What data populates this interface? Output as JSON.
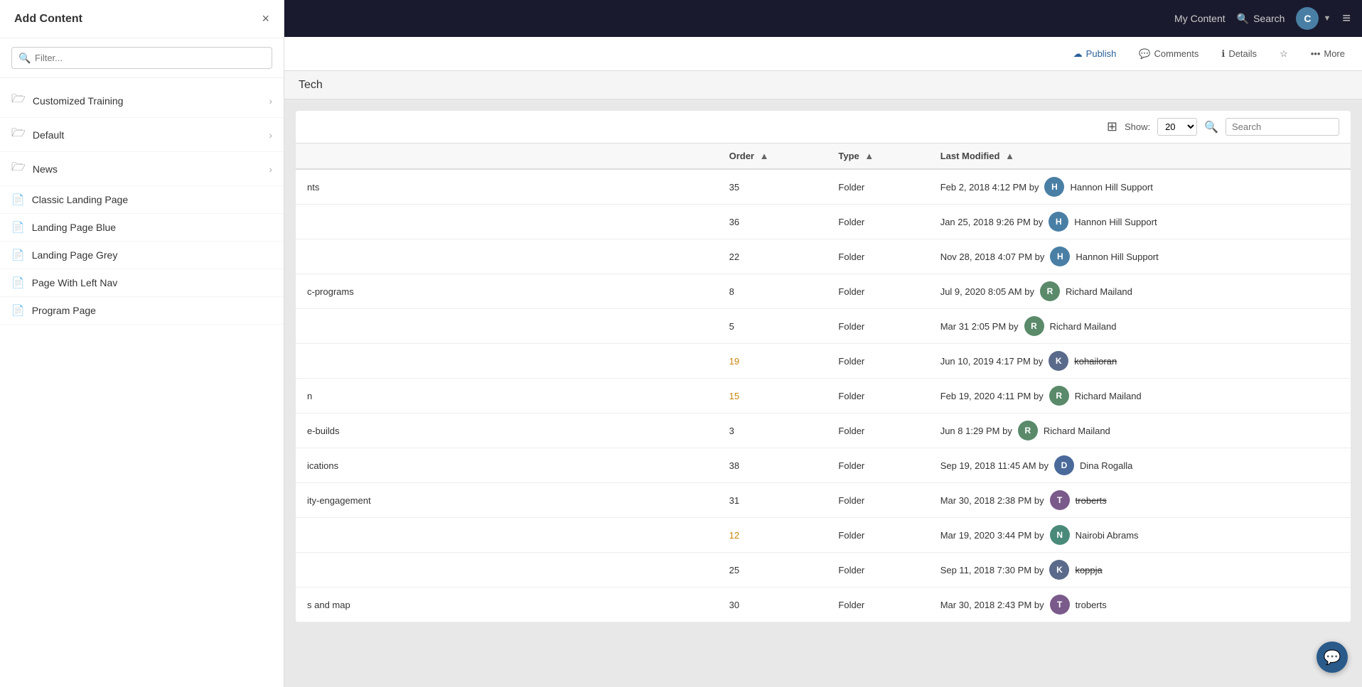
{
  "topnav": {
    "my_content_label": "My Content",
    "search_label": "Search",
    "avatar_letter": "C",
    "hamburger": "≡"
  },
  "secondary_toolbar": {
    "publish_label": "Publish",
    "comments_label": "Comments",
    "details_label": "Details",
    "more_label": "More"
  },
  "page_title": "Tech",
  "list_toolbar": {
    "show_label": "Show:",
    "show_value": "20",
    "search_placeholder": "Search"
  },
  "table": {
    "columns": [
      {
        "key": "name",
        "label": ""
      },
      {
        "key": "order",
        "label": "Order",
        "sortable": true
      },
      {
        "key": "type",
        "label": "Type",
        "sortable": true
      },
      {
        "key": "last_modified",
        "label": "Last Modified",
        "sortable": true
      }
    ],
    "rows": [
      {
        "name": "nts",
        "order": "35",
        "order_highlight": false,
        "type": "Folder",
        "date": "Feb 2, 2018 4:12 PM",
        "by": "by",
        "user_avatar": "H",
        "user_avatar_class": "ua-h",
        "user_name": "Hannon Hill Support",
        "strikethrough": false
      },
      {
        "name": "",
        "order": "36",
        "order_highlight": false,
        "type": "Folder",
        "date": "Jan 25, 2018 9:26 PM",
        "by": "by",
        "user_avatar": "H",
        "user_avatar_class": "ua-h",
        "user_name": "Hannon Hill Support",
        "strikethrough": false
      },
      {
        "name": "",
        "order": "22",
        "order_highlight": false,
        "type": "Folder",
        "date": "Nov 28, 2018 4:07 PM",
        "by": "by",
        "user_avatar": "H",
        "user_avatar_class": "ua-h",
        "user_name": "Hannon Hill Support",
        "strikethrough": false
      },
      {
        "name": "c-programs",
        "order": "8",
        "order_highlight": false,
        "type": "Folder",
        "date": "Jul 9, 2020 8:05 AM",
        "by": "by",
        "user_avatar": "R",
        "user_avatar_class": "ua-r",
        "user_name": "Richard Mailand",
        "strikethrough": false
      },
      {
        "name": "",
        "order": "5",
        "order_highlight": false,
        "type": "Folder",
        "date": "Mar 31 2:05 PM",
        "by": "by",
        "user_avatar": "R",
        "user_avatar_class": "ua-r",
        "user_name": "Richard Mailand",
        "strikethrough": false
      },
      {
        "name": "",
        "order": "19",
        "order_highlight": true,
        "type": "Folder",
        "date": "Jun 10, 2019 4:17 PM",
        "by": "by",
        "user_avatar": "K",
        "user_avatar_class": "ua-k",
        "user_name": "kohailoran",
        "strikethrough": true
      },
      {
        "name": "n",
        "order": "15",
        "order_highlight": true,
        "type": "Folder",
        "date": "Feb 19, 2020 4:11 PM",
        "by": "by",
        "user_avatar": "R",
        "user_avatar_class": "ua-r",
        "user_name": "Richard Mailand",
        "strikethrough": false
      },
      {
        "name": "e-builds",
        "order": "3",
        "order_highlight": false,
        "type": "Folder",
        "date": "Jun 8 1:29 PM",
        "by": "by",
        "user_avatar": "R",
        "user_avatar_class": "ua-r",
        "user_name": "Richard Mailand",
        "strikethrough": false
      },
      {
        "name": "ications",
        "order": "38",
        "order_highlight": false,
        "type": "Folder",
        "date": "Sep 19, 2018 11:45 AM",
        "by": "by",
        "user_avatar": "D",
        "user_avatar_class": "ua-d",
        "user_name": "Dina Rogalla",
        "strikethrough": false
      },
      {
        "name": "ity-engagement",
        "order": "31",
        "order_highlight": false,
        "type": "Folder",
        "date": "Mar 30, 2018 2:38 PM",
        "by": "by",
        "user_avatar": "T",
        "user_avatar_class": "ua-t",
        "user_name": "troberts",
        "strikethrough": true
      },
      {
        "name": "",
        "order": "12",
        "order_highlight": true,
        "type": "Folder",
        "date": "Mar 19, 2020 3:44 PM",
        "by": "by",
        "user_avatar": "N",
        "user_avatar_class": "ua-n",
        "user_name": "Nairobi Abrams",
        "strikethrough": false
      },
      {
        "name": "",
        "order": "25",
        "order_highlight": false,
        "type": "Folder",
        "date": "Sep 11, 2018 7:30 PM",
        "by": "by",
        "user_avatar": "K",
        "user_avatar_class": "ua-k",
        "user_name": "koppja",
        "strikethrough": true
      },
      {
        "name": "s and map",
        "order": "30",
        "order_highlight": false,
        "type": "Folder",
        "date": "Mar 30, 2018 2:43 PM",
        "by": "by",
        "user_avatar": "T",
        "user_avatar_class": "ua-t",
        "user_name": "troberts",
        "strikethrough": false
      }
    ]
  },
  "sidebar": {
    "title": "Add Content",
    "filter_placeholder": "Filter...",
    "close_icon": "×",
    "items": [
      {
        "id": "customized-training",
        "label": "Customized Training",
        "type": "folder",
        "has_arrow": true
      },
      {
        "id": "default",
        "label": "Default",
        "type": "folder",
        "has_arrow": true
      },
      {
        "id": "news",
        "label": "News",
        "type": "folder",
        "has_arrow": true
      },
      {
        "id": "classic-landing-page",
        "label": "Classic Landing Page",
        "type": "doc",
        "has_arrow": false
      },
      {
        "id": "landing-page-blue",
        "label": "Landing Page Blue",
        "type": "doc",
        "has_arrow": false
      },
      {
        "id": "landing-page-grey",
        "label": "Landing Page Grey",
        "type": "doc",
        "has_arrow": false
      },
      {
        "id": "page-with-left-nav",
        "label": "Page With Left Nav",
        "type": "doc",
        "has_arrow": false
      },
      {
        "id": "program-page",
        "label": "Program Page",
        "type": "doc",
        "has_arrow": false
      }
    ]
  },
  "chat": {
    "icon": "💬"
  }
}
